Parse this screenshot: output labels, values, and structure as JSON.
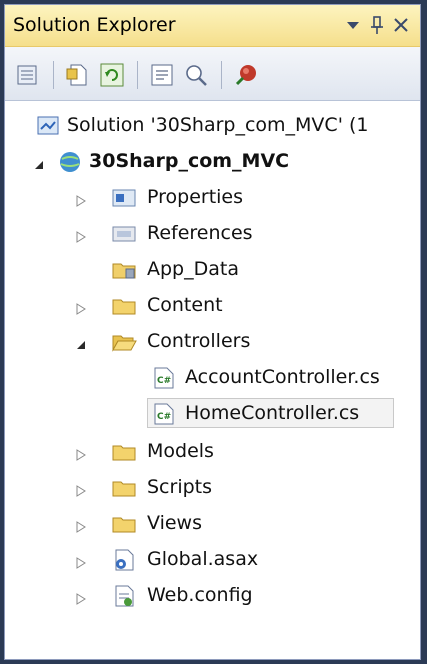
{
  "window": {
    "title": "Solution Explorer"
  },
  "titlebar_icons": [
    "dropdown-arrow-icon",
    "pin-icon",
    "close-icon"
  ],
  "toolbar": {
    "buttons": [
      "properties-icon",
      "show-all-files-icon",
      "refresh-icon",
      "view-code-icon",
      "view-designer-icon",
      "class-diagram-icon"
    ]
  },
  "tree": {
    "solution": "Solution '30Sharp_com_MVC' (1",
    "project": "30Sharp_com_MVC",
    "items": {
      "properties": "Properties",
      "references": "References",
      "app_data": "App_Data",
      "content": "Content",
      "controllers": "Controllers",
      "account_controller": "AccountController.cs",
      "home_controller": "HomeController.cs",
      "models": "Models",
      "scripts": "Scripts",
      "views": "Views",
      "global_asax": "Global.asax",
      "web_config": "Web.config"
    }
  }
}
